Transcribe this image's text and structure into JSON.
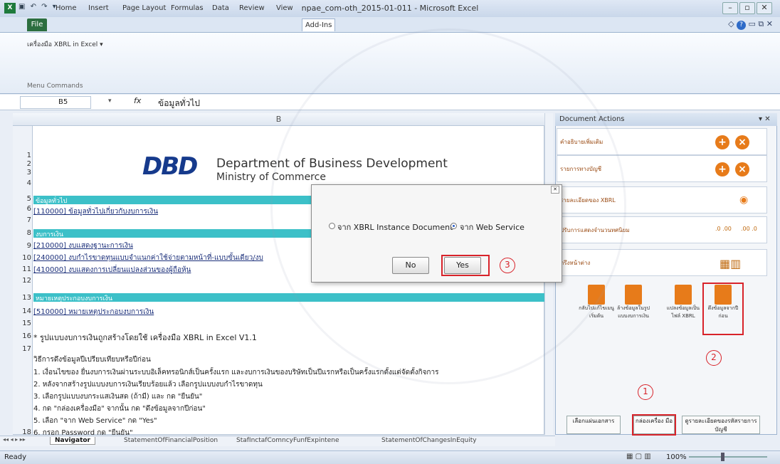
{
  "window": {
    "title": "npae_com-oth_2015-01-011 - Microsoft Excel",
    "app_icon": "X",
    "qat": "▣ ↶ ↷ ▾"
  },
  "tabs": {
    "file": "File",
    "items": [
      "Home",
      "Insert",
      "Page Layout",
      "Formulas",
      "Data",
      "Review",
      "View",
      "Add-Ins"
    ]
  },
  "ribbon": {
    "item": "เครื่องมือ XBRL in Excel ▾",
    "group": "Menu Commands"
  },
  "formula": {
    "name_box": "B5",
    "fx": "fx",
    "value": "ข้อมูลทั่วไป"
  },
  "grid": {
    "column_header": "B",
    "row_numbers": [
      "1",
      "2",
      "3",
      "4",
      "5",
      "6",
      "7",
      "8",
      "9",
      "10",
      "11",
      "12",
      "13",
      "14",
      "15",
      "16",
      "17",
      "18"
    ],
    "logo": "DBD",
    "org_title": "Department of Business Development",
    "org_sub": "Ministry of Commerce",
    "band1": "ข้อมูลทั่วไป",
    "link1": "[110000] ข้อมูลทั่วไปเกี่ยวกับงบการเงิน",
    "band2": "งบการเงิน",
    "link2": "[210000] งบแสดงฐานะการเงิน",
    "link3": "[240000] งบกำไรขาดทุนแบบจำแนกค่าใช้จ่ายตามหน้าที่-แบบขั้นเดียว/งบ",
    "link4": "[410000] งบแสดงการเปลี่ยนแปลงส่วนของผู้ถือหุ้น",
    "band3": "หมายเหตุประกอบงบการเงิน",
    "link5": "[510000] หมายเหตุประกอบงบการเงิน",
    "note": "* รูปแบบงบการเงินถูกสร้างโดยใช้ เครื่องมือ XBRL in Excel V1.1",
    "steps_title": "วิธีการดึงข้อมูลปีเปรียบเทียบหรือปีก่อน",
    "steps": [
      "1. เงื่อนไขของ ยื่นงบการเงินผ่านระบบอิเล็คทรอนิกส์เป็นครั้งแรก และงบการเงินของบริษัทเป็นปีแรกหรือเป็นครั้งแรกตั้งแต่จัดตั้งกิจการ",
      "2. หลังจากสร้างรูปแบบงบการเงินเรียบร้อยแล้ว เลือกรูปแบบงบกำไรขาดทุน",
      "3. เลือกรูปแบบงบกระแสเงินสด (ถ้ามี) และ กด \"ยืนยัน\"",
      "4. กด \"กล่องเครื่องมือ\" จากนั้น กด \"ดึงข้อมูลจากปีก่อน\"",
      "5. เลือก \"จาก Web Service\" กด \"Yes\"",
      "6. กรอก Password กด \"ยืนยัน\""
    ]
  },
  "sheet_tabs": [
    "Navigator",
    "StatementOfFinancialPosition",
    "StafInctafComncyFunfExpintene",
    "StatementOfChangesInEquity"
  ],
  "status": {
    "left": "Ready",
    "zoom": "100%"
  },
  "doc_actions": {
    "title": "Document Actions",
    "rows": [
      "คำอธิบายเพิ่มเติม",
      "รายการทางบัญชี",
      "รายละเอียดของ XBRL",
      "ปรับการแสดงจำนวนทศนิยม",
      "ตรึงหน้าต่าง"
    ],
    "decimal_labels": [
      ".0 .00",
      ".00 .0"
    ],
    "actions": [
      "กลับไปแก้ไขเมนูเริ่มต้น",
      "ล้างข้อมูลในรูปแบบงบการเงิน",
      "แปลงข้อมูลเป็นไฟล์ XBRL",
      "ดึงข้อมูลจากปีก่อน"
    ],
    "bottom": [
      "เลือกแผ่นเอกสาร",
      "กล่องเครื่อง มือ",
      "ดูรายละเอียดของรหัสรายการบัญชี"
    ]
  },
  "dialog": {
    "option1": "จาก XBRL Instance Document",
    "option2": "จาก Web Service",
    "no": "No",
    "yes": "Yes"
  },
  "annotations": {
    "one": "1",
    "two": "2",
    "three": "3"
  },
  "colors": {
    "band": "#3cc0c8",
    "highlight": "#d8232a",
    "accent": "#e77b1a"
  }
}
